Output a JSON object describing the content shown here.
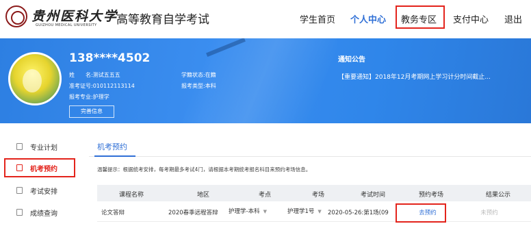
{
  "header": {
    "logo_cn": "贵州医科大学",
    "logo_en": "GUIZHOU MEDICAL UNIVERSITY",
    "site_title": "高等教育自学考试",
    "nav": [
      {
        "label": "学生首页"
      },
      {
        "label": "个人中心"
      },
      {
        "label": "教务专区"
      },
      {
        "label": "支付中心"
      },
      {
        "label": "退出"
      }
    ]
  },
  "profile": {
    "phone": "138****4502",
    "name_label": "姓　　名:",
    "name_value": "测试五五五",
    "ticket_label": "准考证号:",
    "ticket_value": "010112113114",
    "major_label": "报考专业:",
    "major_value": "护理学",
    "status_label": "学籍状态:",
    "status_value": "在籍",
    "type_label": "报考类型:",
    "type_value": "本科",
    "complete_button": "完善信息"
  },
  "notice": {
    "title": "通知公告",
    "text": "【重要通知】2018年12月考期网上学习计分时间截止..."
  },
  "sidebar": {
    "items": [
      {
        "label": "专业计划"
      },
      {
        "label": "机考预约"
      },
      {
        "label": "考试安排"
      },
      {
        "label": "成绩查询"
      }
    ]
  },
  "main": {
    "tab": "机考预约",
    "tip": "温馨提示：根据统考安排，每考期最多考试4门，请根据本考期统考报名科目来预约考场信息。",
    "columns": [
      "课程名称",
      "地区",
      "考点",
      "考场",
      "考试时间",
      "预约考场",
      "结果公示"
    ],
    "rows": [
      {
        "course": "论文答辩",
        "region": "2020春季远程答辩",
        "exam_point": "护理学-本科",
        "exam_room": "护理学1号",
        "exam_time": "2020-05-26:第1场(09",
        "book": "去预约",
        "result": "未预约"
      }
    ]
  },
  "colors": {
    "accent_blue": "#2f6fd6",
    "highlight_red": "#e3231b",
    "banner_blue": "#2f86ea"
  },
  "icons": {
    "sidebar": [
      "document-icon",
      "document-icon",
      "document-icon",
      "document-icon"
    ],
    "select_caret": "chevron-down-icon"
  }
}
